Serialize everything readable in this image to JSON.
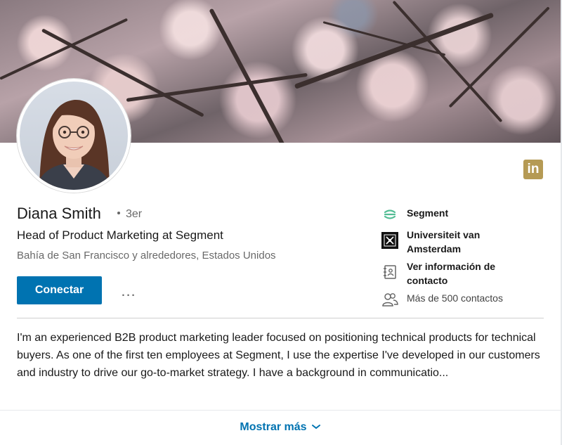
{
  "profile": {
    "name": "Diana Smith",
    "degree": "3er",
    "headline": "Head of Product Marketing at Segment",
    "location": "Bahía de San Francisco y alrededores, Estados Unidos",
    "connect_label": "Conectar",
    "more_label": "...",
    "network_logo_text": "in"
  },
  "side": {
    "company": "Segment",
    "school": "Universiteit van Amsterdam",
    "contact": "Ver información de contacto",
    "connections": "Más de 500 contactos"
  },
  "summary": {
    "text": "I'm an experienced B2B product marketing leader focused on positioning technical products for technical buyers. As one of the first ten employees at Segment, I use the expertise I've developed in our customers and industry to drive our go-to-market strategy. I have a background in communicatio...",
    "show_more_label": "Mostrar más"
  },
  "colors": {
    "accent": "#0073b1",
    "brand_gold": "#b59a54"
  },
  "icons": [
    "segment-logo-icon",
    "university-seal-icon",
    "contact-card-icon",
    "people-icon",
    "linkedin-icon",
    "chevron-down-icon"
  ]
}
